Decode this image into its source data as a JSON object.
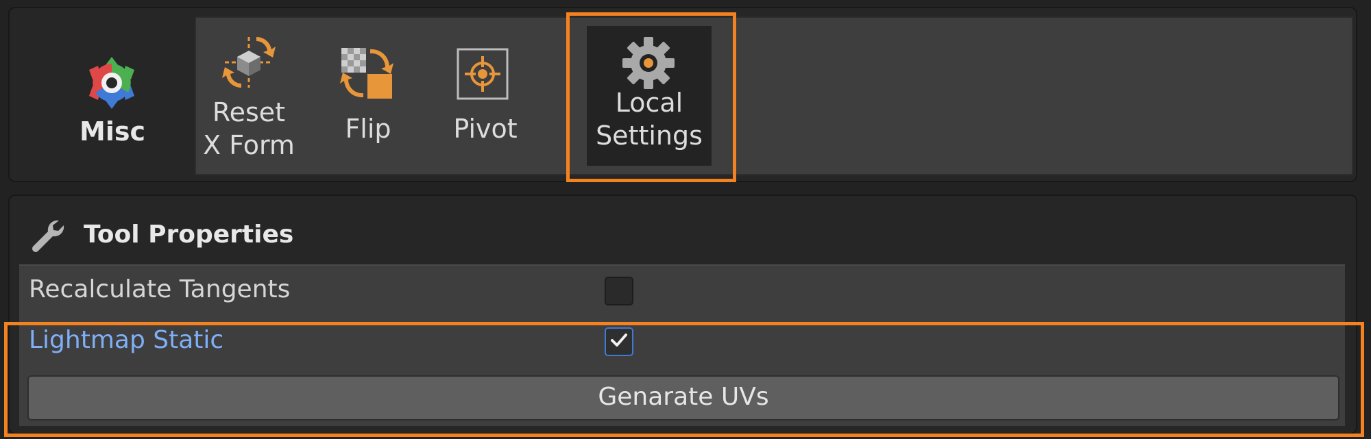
{
  "toolbar": {
    "category": {
      "label": "Misc",
      "icon": "misc-gear-icon"
    },
    "tools": [
      {
        "label_line1": "Reset",
        "label_line2": "X Form",
        "icon": "reset-xform-icon",
        "active": false
      },
      {
        "label_line1": "Flip",
        "label_line2": "",
        "icon": "flip-icon",
        "active": false
      },
      {
        "label_line1": "Pivot",
        "label_line2": "",
        "icon": "pivot-icon",
        "active": false
      },
      {
        "label_line1": "Local",
        "label_line2": "Settings",
        "icon": "gear-icon",
        "active": true
      }
    ]
  },
  "properties": {
    "title": "Tool Properties",
    "icon": "wrench-icon",
    "fields": [
      {
        "label": "Recalculate Tangents",
        "checked": false
      },
      {
        "label": "Lightmap Static",
        "checked": true
      }
    ],
    "generate_button_label": "Genarate UVs"
  },
  "colors": {
    "highlight": "#f58220",
    "modified_label": "#7fb0f7",
    "accent_orange": "#e8963a"
  }
}
